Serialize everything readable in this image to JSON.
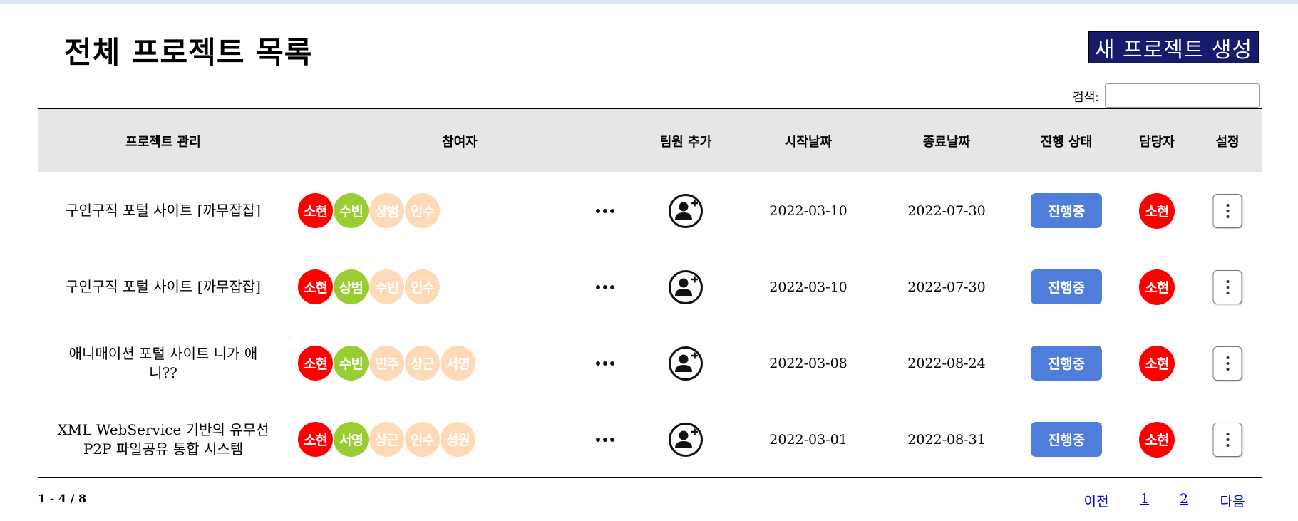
{
  "header": {
    "title": "전체 프로젝트 목록",
    "create_button": "새 프로젝트 생성",
    "search_label": "검색:",
    "search_value": ""
  },
  "table": {
    "columns": [
      "프로젝트 관리",
      "참여자",
      "팀원 추가",
      "시작날짜",
      "종료날짜",
      "진행 상태",
      "담당자",
      "설정"
    ],
    "rows": [
      {
        "project": "구인구직 포털 사이트 [까무잡잡]",
        "participants": [
          {
            "name": "소현",
            "color": "#ff0000"
          },
          {
            "name": "수빈",
            "color": "#9acd32"
          },
          {
            "name": "상범",
            "color": "#ffdab9"
          },
          {
            "name": "인수",
            "color": "#ffdab9"
          }
        ],
        "start": "2022-03-10",
        "end": "2022-07-30",
        "status": "진행중",
        "manager": "소현"
      },
      {
        "project": "구인구직 포털 사이트 [까무잡잡]",
        "participants": [
          {
            "name": "소현",
            "color": "#ff0000"
          },
          {
            "name": "상범",
            "color": "#9acd32"
          },
          {
            "name": "수빈",
            "color": "#ffdab9"
          },
          {
            "name": "인수",
            "color": "#ffdab9"
          }
        ],
        "start": "2022-03-10",
        "end": "2022-07-30",
        "status": "진행중",
        "manager": "소현"
      },
      {
        "project": "애니매이션 포털 사이트 니가 애니??",
        "participants": [
          {
            "name": "소현",
            "color": "#ff0000"
          },
          {
            "name": "수빈",
            "color": "#9acd32"
          },
          {
            "name": "민주",
            "color": "#ffdab9"
          },
          {
            "name": "상근",
            "color": "#ffdab9"
          },
          {
            "name": "서영",
            "color": "#ffdab9"
          }
        ],
        "start": "2022-03-08",
        "end": "2022-08-24",
        "status": "진행중",
        "manager": "소현"
      },
      {
        "project": "XML WebService 기반의 유무선\nP2P 파일공유 통합 시스템",
        "participants": [
          {
            "name": "소현",
            "color": "#ff0000"
          },
          {
            "name": "서영",
            "color": "#9acd32"
          },
          {
            "name": "상근",
            "color": "#ffdab9"
          },
          {
            "name": "인수",
            "color": "#ffdab9"
          },
          {
            "name": "성원",
            "color": "#ffdab9"
          }
        ],
        "start": "2022-03-01",
        "end": "2022-08-31",
        "status": "진행중",
        "manager": "소현"
      }
    ]
  },
  "icons": {
    "more": "more-dots-icon",
    "add_member": "add-user-icon",
    "settings": "kebab-menu-icon"
  },
  "footer": {
    "page_info": "1 - 4 / 8",
    "pagination": [
      "이전",
      "1",
      "2",
      "다음"
    ]
  },
  "colors": {
    "create_button_bg": "#181a6c",
    "status_button_bg": "#4f7ddc",
    "manager_bg": "#ff0000",
    "header_row_bg": "#e6e6e6"
  }
}
